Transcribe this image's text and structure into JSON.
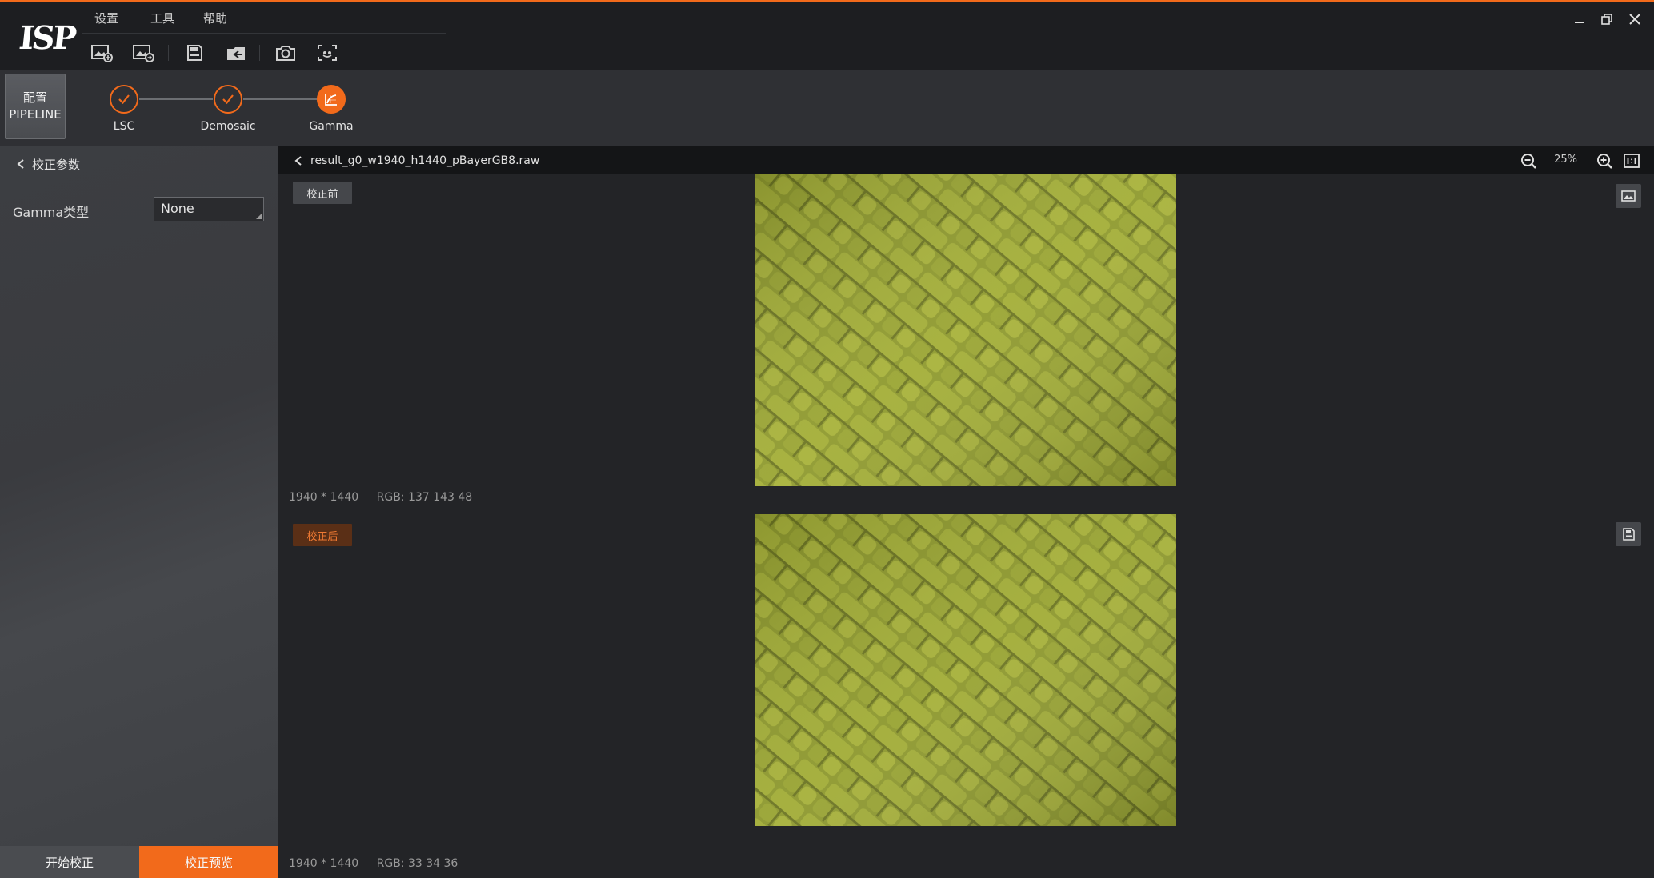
{
  "app": {
    "logo": "ISP",
    "menu": [
      "设置",
      "工具",
      "帮助"
    ],
    "toolbar_icons": [
      "open-image-icon",
      "open-image-set-icon",
      "save-icon",
      "export-icon",
      "camera-icon",
      "capture-icon"
    ],
    "window_controls": [
      "minimize-icon",
      "restore-icon",
      "close-icon"
    ],
    "accent_color": "#f26a1b"
  },
  "pipeline": {
    "config_label_line1": "配置",
    "config_label_line2": "PIPELINE",
    "steps": [
      {
        "label": "LSC",
        "state": "done"
      },
      {
        "label": "Demosaic",
        "state": "done"
      },
      {
        "label": "Gamma",
        "state": "active"
      }
    ]
  },
  "left_panel": {
    "header": "校正参数",
    "param_label": "Gamma类型",
    "param_value": "None",
    "start_button": "开始校正",
    "preview_button": "校正预览"
  },
  "viewer": {
    "filename": "result_g0_w1940_h1440_pBayerGB8.raw",
    "zoom": "25%",
    "before": {
      "tag": "校正前",
      "size": "1940 * 1440",
      "rgb": "RGB: 137 143 48"
    },
    "after": {
      "tag": "校正后",
      "size": "1940 * 1440",
      "rgb": "RGB: 33 34 36"
    }
  }
}
